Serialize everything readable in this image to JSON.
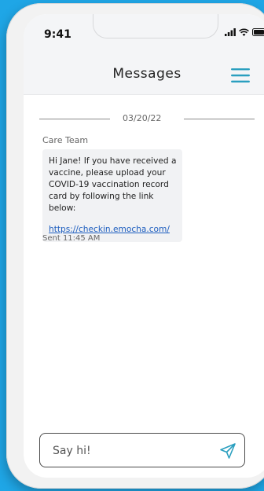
{
  "status": {
    "time": "9:41"
  },
  "header": {
    "title": "Messages",
    "menu_icon": "hamburger-menu-icon"
  },
  "conversation": {
    "date": "03/20/22",
    "sender": "Care Team",
    "message_body": "Hi Jane! If you have received a vaccine, please upload your COVID-19 vaccination record card by following the link below:",
    "message_link": "https://checkin.emocha.com/",
    "sent": "Sent 11:45 AM"
  },
  "composer": {
    "placeholder": "Say hi!",
    "send_icon": "send-paper-plane-icon"
  },
  "colors": {
    "accent": "#2a9fbf",
    "background": "#1fa6e6",
    "link": "#1b5cbe"
  }
}
